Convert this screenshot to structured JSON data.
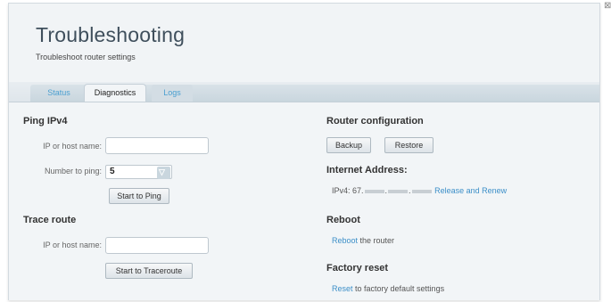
{
  "header": {
    "title": "Troubleshooting",
    "subtitle": "Troubleshoot router settings"
  },
  "tabs": [
    {
      "label": "Status",
      "active": false
    },
    {
      "label": "Diagnostics",
      "active": true
    },
    {
      "label": "Logs",
      "active": false
    }
  ],
  "ping": {
    "heading": "Ping IPv4",
    "host_label": "IP or host name:",
    "host_value": "",
    "count_label": "Number to ping:",
    "count_value": "5",
    "button": "Start to Ping"
  },
  "trace": {
    "heading": "Trace route",
    "host_label": "IP or host name:",
    "host_value": "",
    "button": "Start to Traceroute"
  },
  "router_config": {
    "heading": "Router configuration",
    "backup": "Backup",
    "restore": "Restore"
  },
  "internet": {
    "heading": "Internet Address:",
    "ipv4_prefix": "IPv4: 67.",
    "release_renew": "Release and Renew"
  },
  "reboot": {
    "heading": "Reboot",
    "link": "Reboot",
    "text": " the router"
  },
  "factory": {
    "heading": "Factory reset",
    "link": "Reset",
    "text": " to factory default settings"
  },
  "colors": {
    "link": "#3c8fc8",
    "background": "#e9eef2"
  }
}
